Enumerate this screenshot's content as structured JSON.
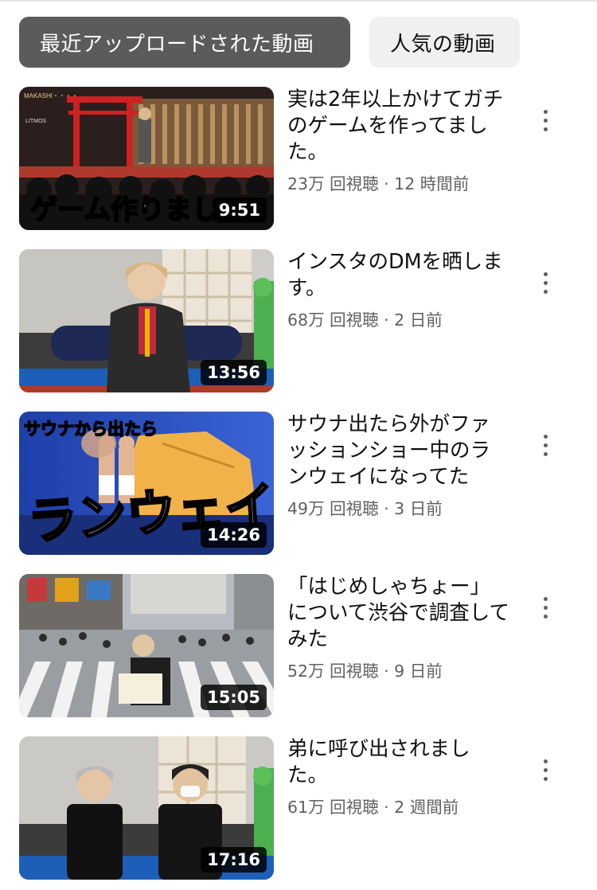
{
  "filters": {
    "recent_label": "最近アップロードされた動画",
    "popular_label": "人気の動画"
  },
  "videos": [
    {
      "title": "実は2年以上かけてガチのゲームを作ってました。",
      "views": "23万 回視聴",
      "age": "12 時間前",
      "duration": "9:51",
      "thumb_caption": "ゲーム作りまし"
    },
    {
      "title": "インスタのDMを晒します。",
      "views": "68万 回視聴",
      "age": "2 日前",
      "duration": "13:56"
    },
    {
      "title": "サウナ出たら外がファッションショー中のランウェイになってた",
      "views": "49万 回視聴",
      "age": "3 日前",
      "duration": "14:26",
      "thumb_caption": "サウナから出たら",
      "thumb_caption_big": "ランウェイ"
    },
    {
      "title": "「はじめしゃちょー」について渋谷で調査してみた",
      "views": "52万 回視聴",
      "age": "9 日前",
      "duration": "15:05"
    },
    {
      "title": "弟に呼び出されました。",
      "views": "61万 回視聴",
      "age": "2 週間前",
      "duration": "17:16"
    }
  ]
}
